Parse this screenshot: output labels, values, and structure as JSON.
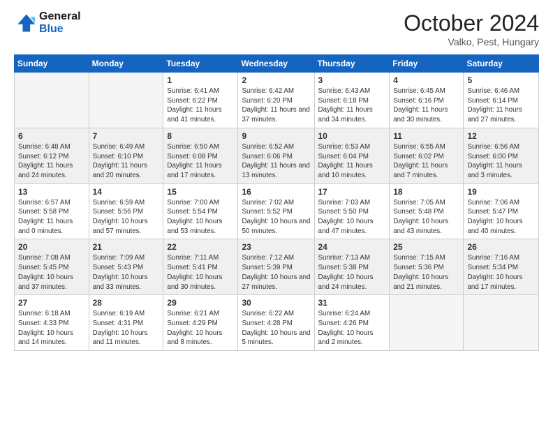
{
  "logo": {
    "line1": "General",
    "line2": "Blue"
  },
  "title": "October 2024",
  "location": "Valko, Pest, Hungary",
  "days_of_week": [
    "Sunday",
    "Monday",
    "Tuesday",
    "Wednesday",
    "Thursday",
    "Friday",
    "Saturday"
  ],
  "weeks": [
    [
      {
        "num": "",
        "empty": true
      },
      {
        "num": "",
        "empty": true
      },
      {
        "num": "1",
        "sunrise": "6:41 AM",
        "sunset": "6:22 PM",
        "daylight": "11 hours and 41 minutes."
      },
      {
        "num": "2",
        "sunrise": "6:42 AM",
        "sunset": "6:20 PM",
        "daylight": "11 hours and 37 minutes."
      },
      {
        "num": "3",
        "sunrise": "6:43 AM",
        "sunset": "6:18 PM",
        "daylight": "11 hours and 34 minutes."
      },
      {
        "num": "4",
        "sunrise": "6:45 AM",
        "sunset": "6:16 PM",
        "daylight": "11 hours and 30 minutes."
      },
      {
        "num": "5",
        "sunrise": "6:46 AM",
        "sunset": "6:14 PM",
        "daylight": "11 hours and 27 minutes."
      }
    ],
    [
      {
        "num": "6",
        "sunrise": "6:48 AM",
        "sunset": "6:12 PM",
        "daylight": "11 hours and 24 minutes."
      },
      {
        "num": "7",
        "sunrise": "6:49 AM",
        "sunset": "6:10 PM",
        "daylight": "11 hours and 20 minutes."
      },
      {
        "num": "8",
        "sunrise": "6:50 AM",
        "sunset": "6:08 PM",
        "daylight": "11 hours and 17 minutes."
      },
      {
        "num": "9",
        "sunrise": "6:52 AM",
        "sunset": "6:06 PM",
        "daylight": "11 hours and 13 minutes."
      },
      {
        "num": "10",
        "sunrise": "6:53 AM",
        "sunset": "6:04 PM",
        "daylight": "11 hours and 10 minutes."
      },
      {
        "num": "11",
        "sunrise": "6:55 AM",
        "sunset": "6:02 PM",
        "daylight": "11 hours and 7 minutes."
      },
      {
        "num": "12",
        "sunrise": "6:56 AM",
        "sunset": "6:00 PM",
        "daylight": "11 hours and 3 minutes."
      }
    ],
    [
      {
        "num": "13",
        "sunrise": "6:57 AM",
        "sunset": "5:58 PM",
        "daylight": "11 hours and 0 minutes."
      },
      {
        "num": "14",
        "sunrise": "6:59 AM",
        "sunset": "5:56 PM",
        "daylight": "10 hours and 57 minutes."
      },
      {
        "num": "15",
        "sunrise": "7:00 AM",
        "sunset": "5:54 PM",
        "daylight": "10 hours and 53 minutes."
      },
      {
        "num": "16",
        "sunrise": "7:02 AM",
        "sunset": "5:52 PM",
        "daylight": "10 hours and 50 minutes."
      },
      {
        "num": "17",
        "sunrise": "7:03 AM",
        "sunset": "5:50 PM",
        "daylight": "10 hours and 47 minutes."
      },
      {
        "num": "18",
        "sunrise": "7:05 AM",
        "sunset": "5:48 PM",
        "daylight": "10 hours and 43 minutes."
      },
      {
        "num": "19",
        "sunrise": "7:06 AM",
        "sunset": "5:47 PM",
        "daylight": "10 hours and 40 minutes."
      }
    ],
    [
      {
        "num": "20",
        "sunrise": "7:08 AM",
        "sunset": "5:45 PM",
        "daylight": "10 hours and 37 minutes."
      },
      {
        "num": "21",
        "sunrise": "7:09 AM",
        "sunset": "5:43 PM",
        "daylight": "10 hours and 33 minutes."
      },
      {
        "num": "22",
        "sunrise": "7:11 AM",
        "sunset": "5:41 PM",
        "daylight": "10 hours and 30 minutes."
      },
      {
        "num": "23",
        "sunrise": "7:12 AM",
        "sunset": "5:39 PM",
        "daylight": "10 hours and 27 minutes."
      },
      {
        "num": "24",
        "sunrise": "7:13 AM",
        "sunset": "5:38 PM",
        "daylight": "10 hours and 24 minutes."
      },
      {
        "num": "25",
        "sunrise": "7:15 AM",
        "sunset": "5:36 PM",
        "daylight": "10 hours and 21 minutes."
      },
      {
        "num": "26",
        "sunrise": "7:16 AM",
        "sunset": "5:34 PM",
        "daylight": "10 hours and 17 minutes."
      }
    ],
    [
      {
        "num": "27",
        "sunrise": "6:18 AM",
        "sunset": "4:33 PM",
        "daylight": "10 hours and 14 minutes."
      },
      {
        "num": "28",
        "sunrise": "6:19 AM",
        "sunset": "4:31 PM",
        "daylight": "10 hours and 11 minutes."
      },
      {
        "num": "29",
        "sunrise": "6:21 AM",
        "sunset": "4:29 PM",
        "daylight": "10 hours and 8 minutes."
      },
      {
        "num": "30",
        "sunrise": "6:22 AM",
        "sunset": "4:28 PM",
        "daylight": "10 hours and 5 minutes."
      },
      {
        "num": "31",
        "sunrise": "6:24 AM",
        "sunset": "4:26 PM",
        "daylight": "10 hours and 2 minutes."
      },
      {
        "num": "",
        "empty": true
      },
      {
        "num": "",
        "empty": true
      }
    ]
  ],
  "labels": {
    "sunrise": "Sunrise:",
    "sunset": "Sunset:",
    "daylight": "Daylight:"
  },
  "colors": {
    "header_bg": "#1565c0",
    "row_shaded": "#f0f0f0"
  }
}
